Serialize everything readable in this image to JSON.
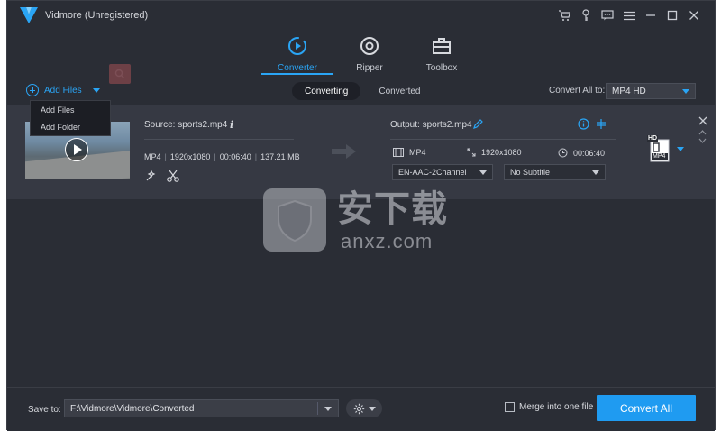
{
  "app": {
    "title": "Vidmore (Unregistered)"
  },
  "colors": {
    "accent": "#2aa5f5",
    "background": "#2a2d35",
    "row": "#363943",
    "convert_button": "#1f9bf1"
  },
  "window_controls": [
    "cart-icon",
    "key-icon",
    "feedback-icon",
    "menu-icon",
    "minimize-icon",
    "maximize-icon",
    "close-icon"
  ],
  "main_tabs": [
    {
      "label": "Converter",
      "icon": "converter-icon",
      "active": true
    },
    {
      "label": "Ripper",
      "icon": "ripper-icon",
      "active": false
    },
    {
      "label": "Toolbox",
      "icon": "toolbox-icon",
      "active": false
    }
  ],
  "toolbar": {
    "add_files_label": "Add Files",
    "segments": [
      "Converting",
      "Converted"
    ],
    "convert_all_label": "Convert All to:",
    "convert_all_format": "MP4 HD"
  },
  "dropdown": {
    "items": [
      "Add Files",
      "Add Folder"
    ]
  },
  "file": {
    "source_name": "Source: sports2.mp4",
    "info_glyph": "i",
    "format": "MP4",
    "resolution": "1920x1080",
    "duration": "00:06:40",
    "size": "137.21 MB",
    "output_name": "Output: sports2.mp4",
    "out_format": "MP4",
    "out_resolution": "1920x1080",
    "out_duration": "00:06:40",
    "audio_track": "EN-AAC-2Channel",
    "subtitle": "No Subtitle",
    "hd_badge": "HD",
    "format_badge": "MP4"
  },
  "watermark": {
    "big": "安下载",
    "small": "anxz.com"
  },
  "bottom": {
    "save_label": "Save to:",
    "save_path": "F:\\Vidmore\\Vidmore\\Converted",
    "merge_label": "Merge into one file",
    "merge_checked": false,
    "convert_button": "Convert All"
  }
}
